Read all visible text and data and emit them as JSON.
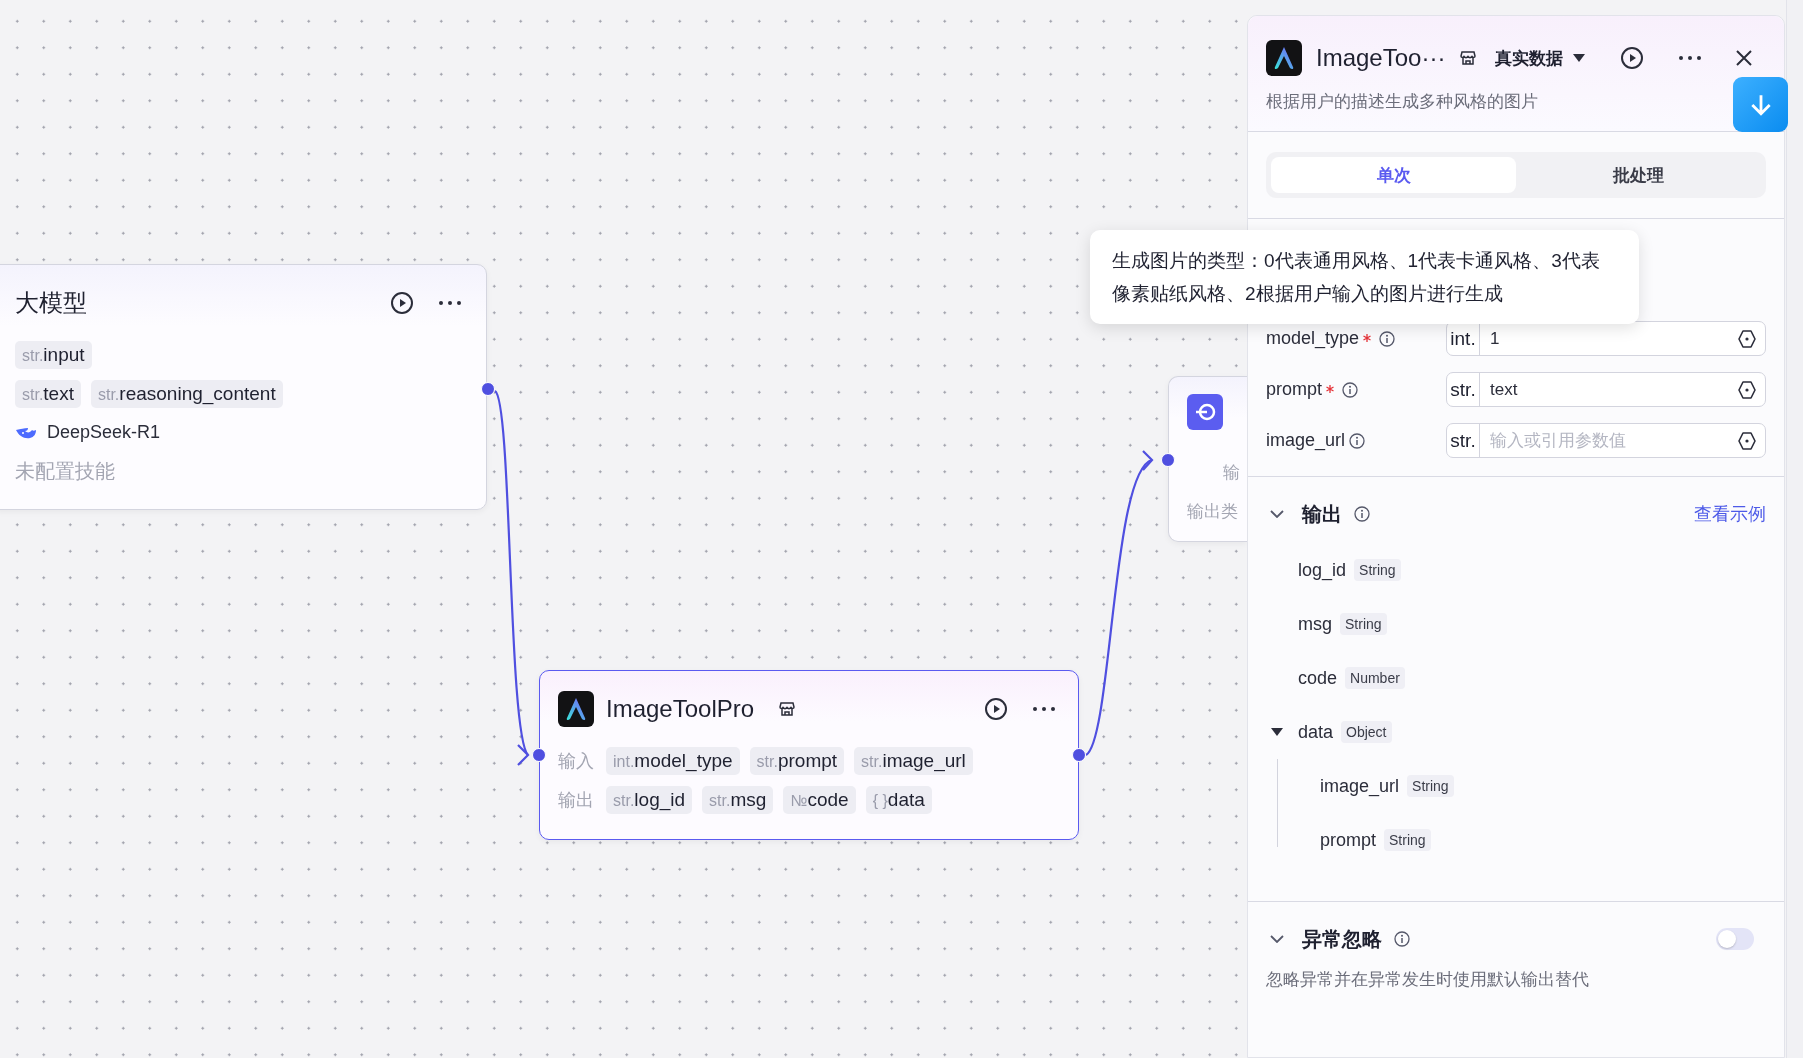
{
  "canvas": {
    "llm_node": {
      "title": "大模型",
      "inputs": [
        {
          "type": "str.",
          "name": "input"
        }
      ],
      "outputs": [
        {
          "type": "str.",
          "name": "text"
        },
        {
          "type": "str.",
          "name": "reasoning_content"
        }
      ],
      "model": "DeepSeek-R1",
      "skills": "未配置技能"
    },
    "tool_node": {
      "title": "ImageToolPro",
      "selected": true,
      "rows": [
        {
          "label": "输入",
          "params": [
            {
              "type": "int.",
              "name": "model_type"
            },
            {
              "type": "str.",
              "name": "prompt"
            },
            {
              "type": "str.",
              "name": "image_url"
            }
          ]
        },
        {
          "label": "输出",
          "params": [
            {
              "type": "str.",
              "name": "log_id"
            },
            {
              "type": "str.",
              "name": "msg"
            },
            {
              "type": "№",
              "name": "code"
            },
            {
              "type": "{ }",
              "name": "data"
            }
          ]
        }
      ]
    },
    "end_node": {
      "row_labels": [
        "输",
        "输出类"
      ]
    }
  },
  "panel": {
    "title": "ImageToo···",
    "data_mode": "真实数据",
    "description": "根据用户的描述生成多种风格的图片",
    "tabs": [
      {
        "label": "单次",
        "selected": true
      },
      {
        "label": "批处理",
        "selected": false
      }
    ],
    "tooltip": "生成图片的类型：0代表通用风格、1代表卡通风格、3代表像素贴纸风格、2根据用户输入的图片进行生成",
    "inputs": [
      {
        "name": "model_type",
        "required": true,
        "type": "int.",
        "value": "1"
      },
      {
        "name": "prompt",
        "required": true,
        "type": "str.",
        "value": "text"
      },
      {
        "name": "image_url",
        "required": false,
        "type": "str.",
        "placeholder": "输入或引用参数值"
      }
    ],
    "output": {
      "title": "输出",
      "link": "查看示例",
      "expanded": true,
      "fields": [
        {
          "name": "log_id",
          "type": "String"
        },
        {
          "name": "msg",
          "type": "String"
        },
        {
          "name": "code",
          "type": "Number"
        },
        {
          "name": "data",
          "type": "Object",
          "expanded": true,
          "children": [
            {
              "name": "image_url",
              "type": "String"
            },
            {
              "name": "prompt",
              "type": "String"
            }
          ]
        }
      ]
    },
    "exception": {
      "title": "异常忽略",
      "expanded": true,
      "on": false,
      "description": "忽略异常并在异常发生时使用默认输出替代"
    }
  }
}
